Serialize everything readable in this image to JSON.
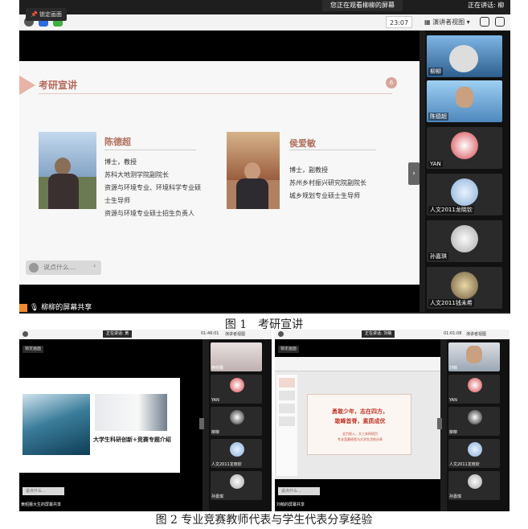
{
  "figure1": {
    "banner": "您正在观看柳柳的屏幕",
    "banner_right": "正在讲话: 柳",
    "time": "23:07",
    "view_label": "演讲者视图",
    "pin_label": "锁定画面",
    "slide": {
      "title": "考研宣讲",
      "page_badge": "6",
      "person1": {
        "name": "陈德超",
        "lines": [
          "博士，教授",
          "苏科大地测学院副院长",
          "资源与环境专业、环境科学专业硕",
          "士生导师",
          "资源与环境专业硕士招生负责人"
        ]
      },
      "person2": {
        "name": "侯爱敏",
        "lines": [
          "博士，副教授",
          "苏州乡村振兴研究院副院长",
          "城乡规划专业硕士生导师"
        ]
      },
      "chat_placeholder": "说点什么..."
    },
    "share_label": "柳柳的屏幕共享",
    "participants": [
      "柳柳",
      "陈德超",
      "YAN",
      "人文2011龙晓钦",
      "孙嘉琪",
      "人文2011钱未希"
    ]
  },
  "caption1": "图 1　考研宣讲",
  "figure2": {
    "left": {
      "banner": "正在讲话: 黄",
      "time": "01:46:01",
      "view_label": "演讲者视图",
      "pin_label": "锁定画面",
      "slide_title": "大学生科研创新+竞赛专题介绍",
      "chat_placeholder": "说点什么...",
      "share_label": "黄昭蕾大生的屏幕共享",
      "participants": [
        "黄昭蕾",
        "YAN",
        "柳柳",
        "人文2011龙晓钦",
        "孙嘉琪"
      ]
    },
    "right": {
      "banner": "正在讲话: 刘萌",
      "time": "01:01:08",
      "view_label": "演讲者视图",
      "pin_label": "锁定画面",
      "slide_line1": "勇敢少年，志在四方，",
      "slide_line2": "敢峰首脊，素质成优",
      "slide_line3": "全力投入，大三本科项目",
      "slide_line4": "专业竞赛经验与大学生活的分享",
      "chat_placeholder": "说点什么...",
      "share_label": "刘萌的屏幕共享",
      "participants": [
        "刘萌",
        "YAN",
        "柳柳",
        "人文2011龙晓钦",
        "孙嘉琪"
      ]
    }
  },
  "caption2": "图 2  专业竞赛教师代表与学生代表分享经验"
}
